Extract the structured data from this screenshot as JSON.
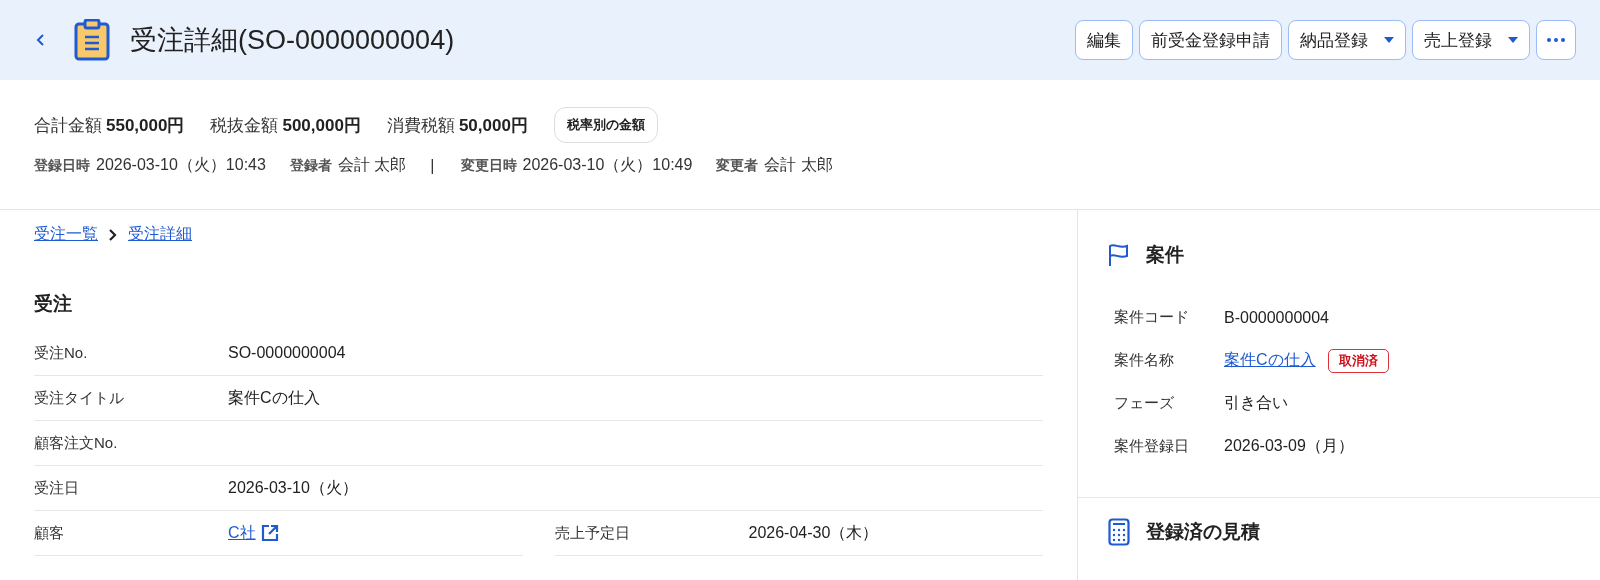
{
  "header": {
    "title": "受注詳細(SO-0000000004)",
    "buttons": [
      {
        "label": "編集",
        "kind": "plain"
      },
      {
        "label": "前受金登録申請",
        "kind": "plain"
      },
      {
        "label": "納品登録",
        "kind": "dropdown"
      },
      {
        "label": "売上登録",
        "kind": "dropdown"
      },
      {
        "kind": "more"
      }
    ]
  },
  "totals": [
    {
      "label": "合計金額",
      "value": "550,000円"
    },
    {
      "label": "税抜金額",
      "value": "500,000円"
    },
    {
      "label": "消費税額",
      "value": "50,000円"
    }
  ],
  "tax_button": "税率別の金額",
  "meta": [
    {
      "label": "登録日時",
      "value": "2026-03-10（火）10:43"
    },
    {
      "label": "登録者",
      "value": "会計 太郎"
    },
    {
      "kind": "separator",
      "value": "|"
    },
    {
      "label": "変更日時",
      "value": "2026-03-10（火）10:49"
    },
    {
      "label": "変更者",
      "value": "会計 太郎"
    }
  ],
  "breadcrumb": [
    "受注一覧",
    "受注詳細"
  ],
  "order": {
    "heading": "受注",
    "rows": [
      [
        {
          "label": "受注No.",
          "value": "SO-0000000004",
          "kind": "text"
        }
      ],
      [
        {
          "label": "受注タイトル",
          "value": "案件Cの仕入",
          "kind": "text"
        }
      ],
      [
        {
          "label": "顧客注文No.",
          "kind": "text"
        }
      ],
      [
        {
          "label": "受注日",
          "value": "2026-03-10（火）",
          "kind": "text"
        }
      ],
      [
        {
          "label": "顧客",
          "value": "C社",
          "kind": "external_link"
        },
        {
          "label": "売上予定日",
          "value": "2026-04-30（木）",
          "kind": "text"
        }
      ]
    ]
  },
  "deal": {
    "heading": "案件",
    "rows": [
      {
        "label": "案件コード",
        "value": "B-0000000004",
        "kind": "text"
      },
      {
        "label": "案件名称",
        "value": "案件Cの仕入",
        "kind": "link",
        "badge": "取消済"
      },
      {
        "label": "フェーズ",
        "value": "引き合い",
        "kind": "text"
      },
      {
        "label": "案件登録日",
        "value": "2026-03-09（月）",
        "kind": "text"
      }
    ]
  },
  "estimates": {
    "heading": "登録済の見積"
  }
}
